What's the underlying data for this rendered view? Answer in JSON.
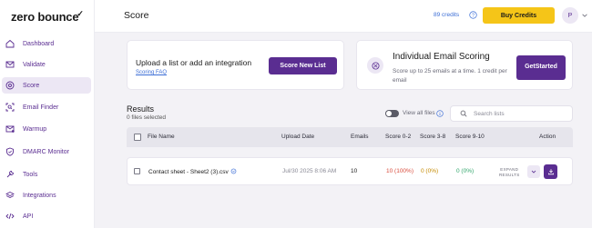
{
  "brand": {
    "logo_text": "zero bounce",
    "accent": "#5a2d91",
    "buy_color": "#f5c518"
  },
  "sidebar": {
    "items": [
      {
        "label": "Dashboard",
        "icon": "home-icon"
      },
      {
        "label": "Validate",
        "icon": "envelope-icon"
      },
      {
        "label": "Score",
        "icon": "target-icon",
        "active": true
      },
      {
        "label": "Email Finder",
        "icon": "finder-icon"
      },
      {
        "label": "Warmup",
        "icon": "warmup-icon"
      },
      {
        "label": "DMARC Monitor",
        "icon": "shield-icon"
      },
      {
        "label": "Tools",
        "icon": "tools-icon"
      },
      {
        "label": "Integrations",
        "icon": "layers-icon"
      },
      {
        "label": "API",
        "icon": "code-icon"
      }
    ]
  },
  "header": {
    "title": "Score",
    "credits": "89 credits",
    "buy_label": "Buy Credits",
    "avatar_initial": "P"
  },
  "upload_card": {
    "title": "Upload a list or add an integration",
    "link": "Scoring FAQ",
    "button": "Score New List"
  },
  "individual_card": {
    "title": "Individual Email Scoring",
    "description": "Score up to 25 emails at a time. 1 credit per email",
    "button_line1": "Get",
    "button_line2": "Started"
  },
  "results": {
    "title": "Results",
    "selected": "0 files selected",
    "view_all": "View all files",
    "search_placeholder": "Search lists",
    "columns": {
      "file_name": "File Name",
      "upload_date": "Upload Date",
      "emails": "Emails",
      "score_0_2": "Score 0-2",
      "score_3_8": "Score 3-8",
      "score_9_10": "Score 9-10",
      "action": "Action"
    },
    "rows": [
      {
        "file_name": "Contact sheet - Sheet2 (3).csv",
        "upload_date": "Jul/30 2025 8:06 AM",
        "emails": "10",
        "score_0_2": "10 (100%)",
        "score_3_8": "0 (0%)",
        "score_9_10": "0 (0%)",
        "expand_line1": "EXPAND",
        "expand_line2": "RESULTS"
      }
    ]
  }
}
